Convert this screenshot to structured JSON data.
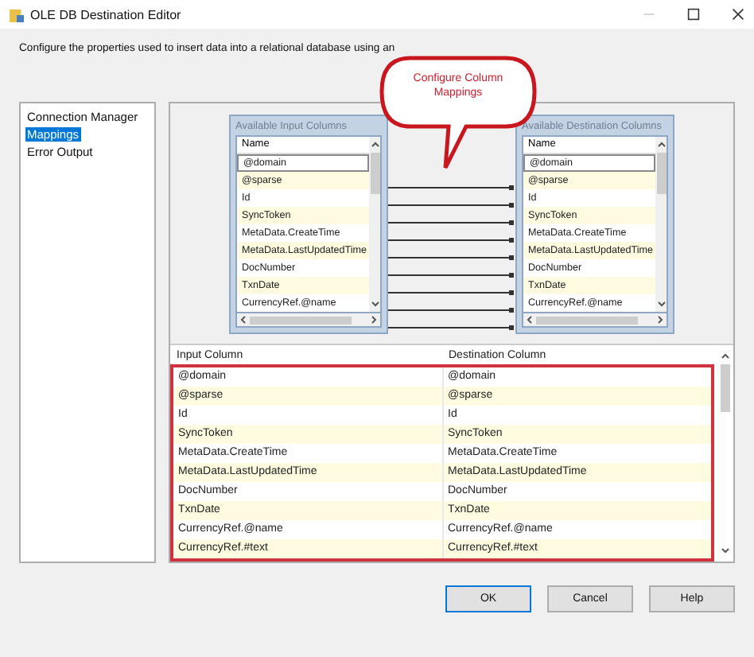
{
  "window": {
    "title": "OLE DB Destination Editor"
  },
  "description": "Configure the properties used to insert data into a relational database using an",
  "callout": "Configure Column Mappings",
  "nav": [
    {
      "label": "Connection Manager",
      "selected": false
    },
    {
      "label": "Mappings",
      "selected": true
    },
    {
      "label": "Error Output",
      "selected": false
    }
  ],
  "input_columns": {
    "title": "Available Input Columns",
    "header": "Name",
    "rows": [
      "@domain",
      "@sparse",
      "Id",
      "SyncToken",
      "MetaData.CreateTime",
      "MetaData.LastUpdatedTime",
      "DocNumber",
      "TxnDate",
      "CurrencyRef.@name"
    ]
  },
  "destination_columns": {
    "title": "Available Destination Columns",
    "header": "Name",
    "rows": [
      "@domain",
      "@sparse",
      "Id",
      "SyncToken",
      "MetaData.CreateTime",
      "MetaData.LastUpdatedTime",
      "DocNumber",
      "TxnDate",
      "CurrencyRef.@name"
    ]
  },
  "mappings": {
    "columns": [
      "Input Column",
      "Destination Column"
    ],
    "rows": [
      [
        "@domain",
        "@domain"
      ],
      [
        "@sparse",
        "@sparse"
      ],
      [
        "Id",
        "Id"
      ],
      [
        "SyncToken",
        "SyncToken"
      ],
      [
        "MetaData.CreateTime",
        "MetaData.CreateTime"
      ],
      [
        "MetaData.LastUpdatedTime",
        "MetaData.LastUpdatedTime"
      ],
      [
        "DocNumber",
        "DocNumber"
      ],
      [
        "TxnDate",
        "TxnDate"
      ],
      [
        "CurrencyRef.@name",
        "CurrencyRef.@name"
      ],
      [
        "CurrencyRef.#text",
        "CurrencyRef.#text"
      ]
    ]
  },
  "buttons": [
    {
      "label": "OK",
      "kind": "default"
    },
    {
      "label": "Cancel",
      "kind": "normal"
    },
    {
      "label": "Help",
      "kind": "normal"
    }
  ]
}
